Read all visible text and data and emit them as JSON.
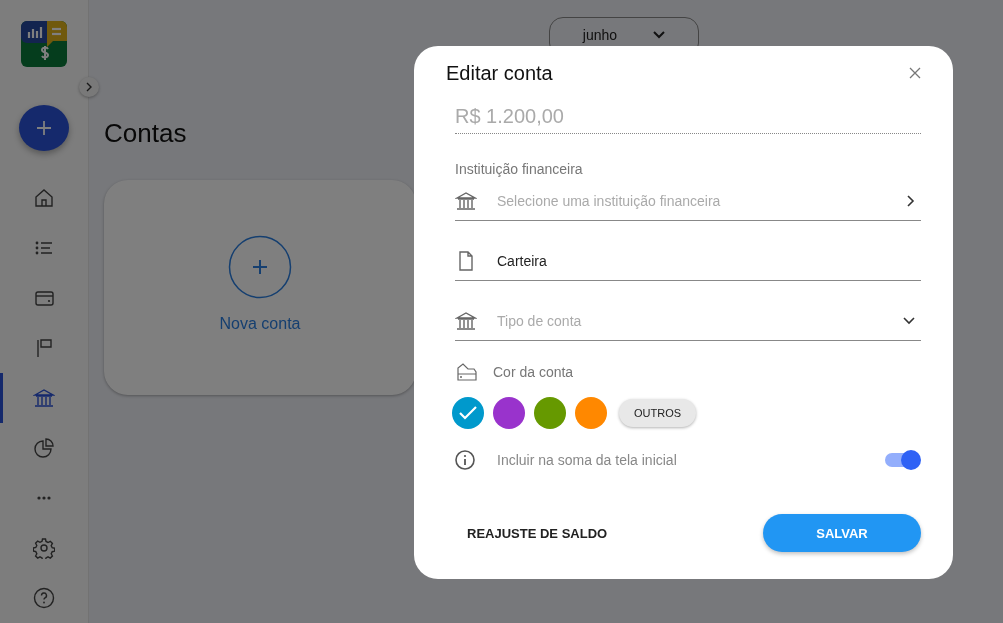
{
  "sidebar": {
    "items": [
      {
        "kind": "home",
        "selected": false
      },
      {
        "kind": "list",
        "selected": false
      },
      {
        "kind": "wallet",
        "selected": false
      },
      {
        "kind": "flag",
        "selected": false
      },
      {
        "kind": "bank",
        "selected": true
      },
      {
        "kind": "pie",
        "selected": false
      },
      {
        "kind": "more",
        "selected": false
      },
      {
        "kind": "settings",
        "selected": false
      },
      {
        "kind": "help",
        "selected": false
      }
    ]
  },
  "page": {
    "title": "Contas",
    "month": "junho",
    "new_card": {
      "label": "Nova conta"
    }
  },
  "dialog": {
    "title": "Editar conta",
    "fields": [
      {
        "kind": "amount",
        "value": "R$ 1.200,00"
      },
      {
        "kind": "picker",
        "label": "Instituição financeira",
        "placeholder": "Selecione uma instituição financeira"
      },
      {
        "kind": "text",
        "value": "Carteira"
      },
      {
        "kind": "dropdown",
        "placeholder": "Tipo de conta"
      }
    ],
    "color_label": "Cor da conta",
    "colors": [
      {
        "color": "#0099cc",
        "selected": true
      },
      {
        "color": "#9933cc",
        "selected": false
      },
      {
        "color": "#669900",
        "selected": false
      },
      {
        "color": "#ff8800",
        "selected": false
      }
    ],
    "more_colors": "OUTROS",
    "toggle": {
      "label": "Incluir na soma da tela inicial",
      "on": true
    },
    "buttons": {
      "secondary": "REAJUSTE DE SALDO",
      "primary": "SALVAR"
    }
  }
}
